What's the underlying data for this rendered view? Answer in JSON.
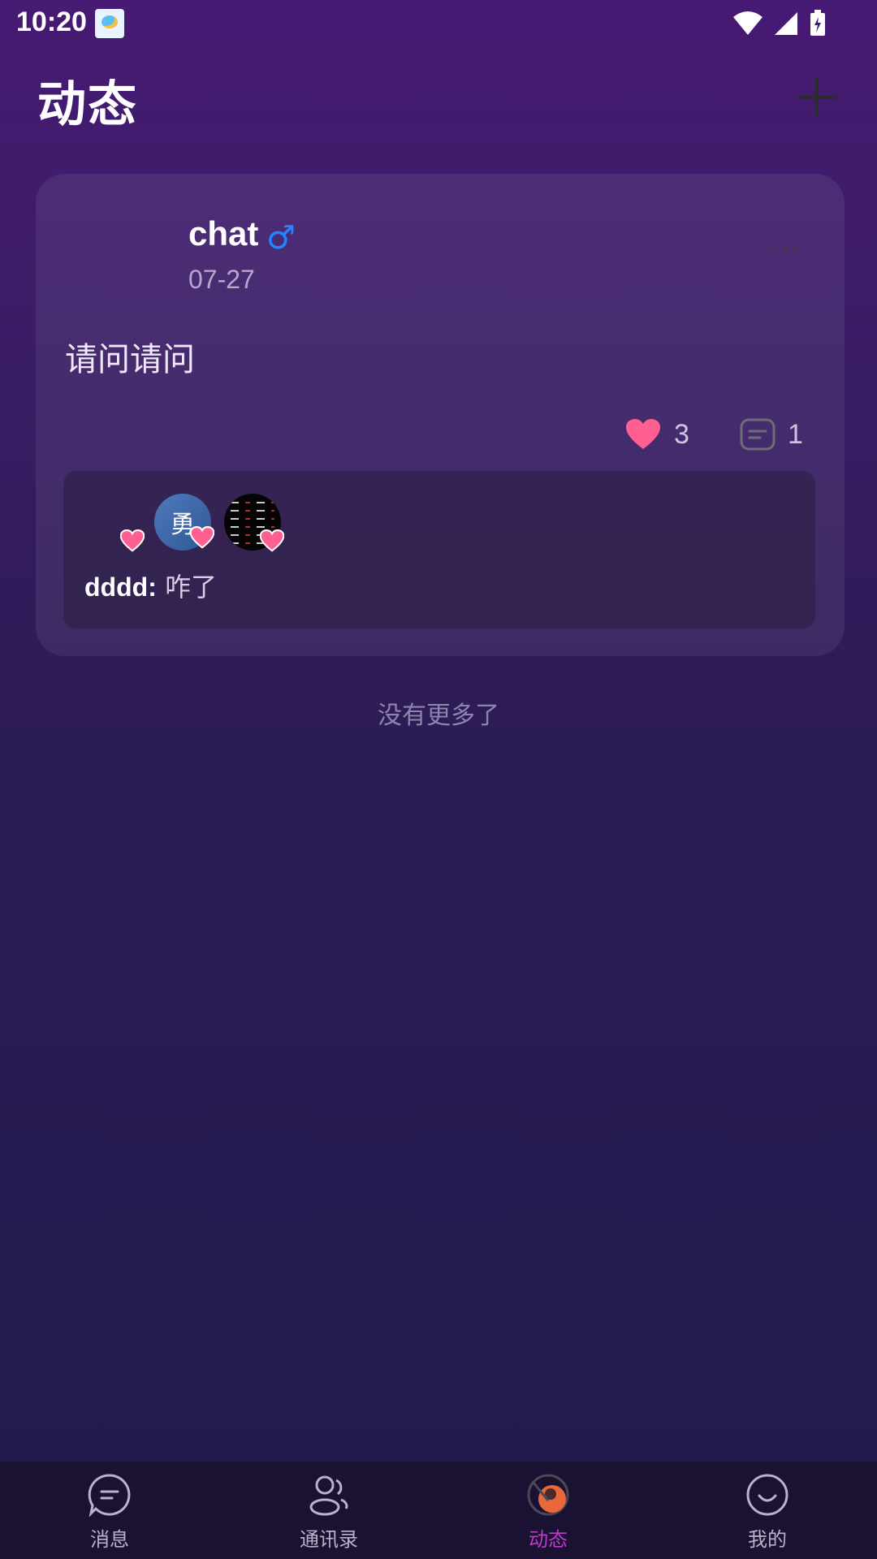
{
  "status_bar": {
    "time": "10:20"
  },
  "header": {
    "title": "动态"
  },
  "post": {
    "username": "chat",
    "gender_symbol": "♂",
    "date": "07-27",
    "content": "请问请问",
    "like_count": "3",
    "comment_count": "1",
    "likers": [
      {
        "avatar_text": ""
      },
      {
        "avatar_text": "勇"
      },
      {
        "avatar_text": ""
      }
    ],
    "comments": [
      {
        "author": "dddd:",
        "text": " 咋了"
      }
    ]
  },
  "feed_end_text": "没有更多了",
  "nav": {
    "items": [
      {
        "label": "消息",
        "icon": "message-icon"
      },
      {
        "label": "通讯录",
        "icon": "contacts-icon"
      },
      {
        "label": "动态",
        "icon": "moments-icon",
        "active": true
      },
      {
        "label": "我的",
        "icon": "profile-icon"
      }
    ]
  },
  "colors": {
    "like": "#ff5f91",
    "active_nav": "#b93ec9",
    "gender": "#2684ff"
  }
}
